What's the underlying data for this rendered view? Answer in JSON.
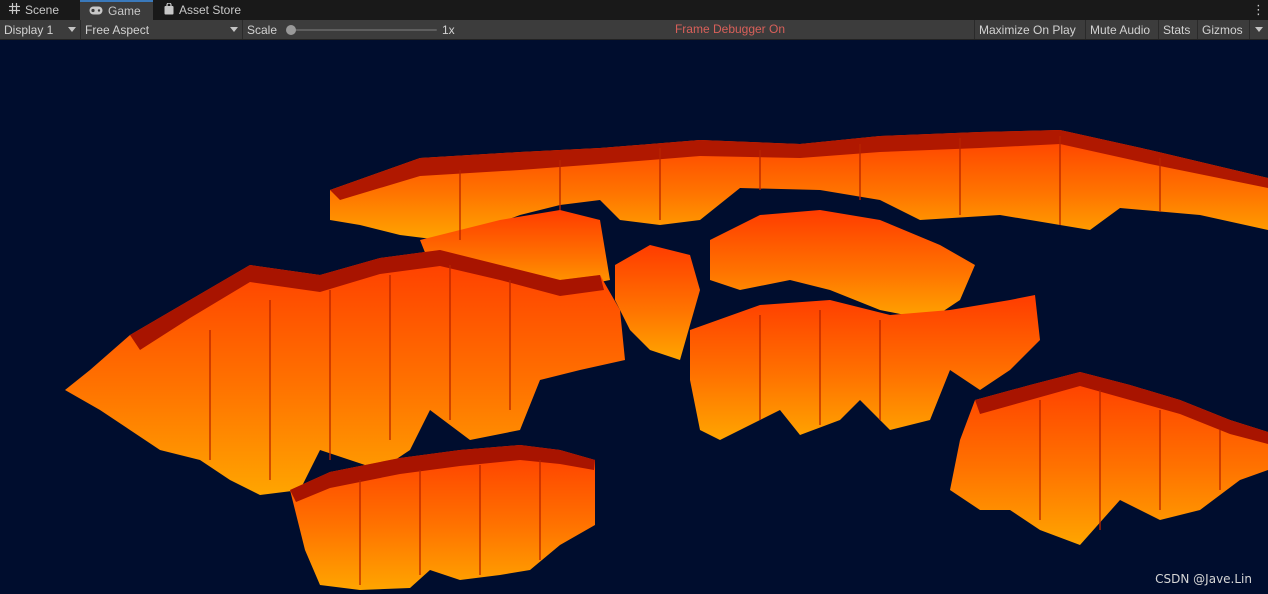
{
  "tabs": [
    {
      "label": "Scene",
      "icon": "grid-icon"
    },
    {
      "label": "Game",
      "icon": "gamepad-icon"
    },
    {
      "label": "Asset Store",
      "icon": "shopping-bag-icon"
    }
  ],
  "toolbar": {
    "display": "Display 1",
    "aspect": "Free Aspect",
    "scale_label": "Scale",
    "scale_value": "1x",
    "scale_slider_level": 0.0,
    "frame_debugger": "Frame Debugger On",
    "maximize": "Maximize On Play",
    "mute": "Mute Audio",
    "stats": "Stats",
    "gizmos": "Gizmos"
  },
  "viewport": {
    "background": "#000d2e",
    "watermark": "CSDN @Jave.Lin",
    "fill_top": "#ff4a00",
    "fill_bottom": "#ff9a00"
  }
}
